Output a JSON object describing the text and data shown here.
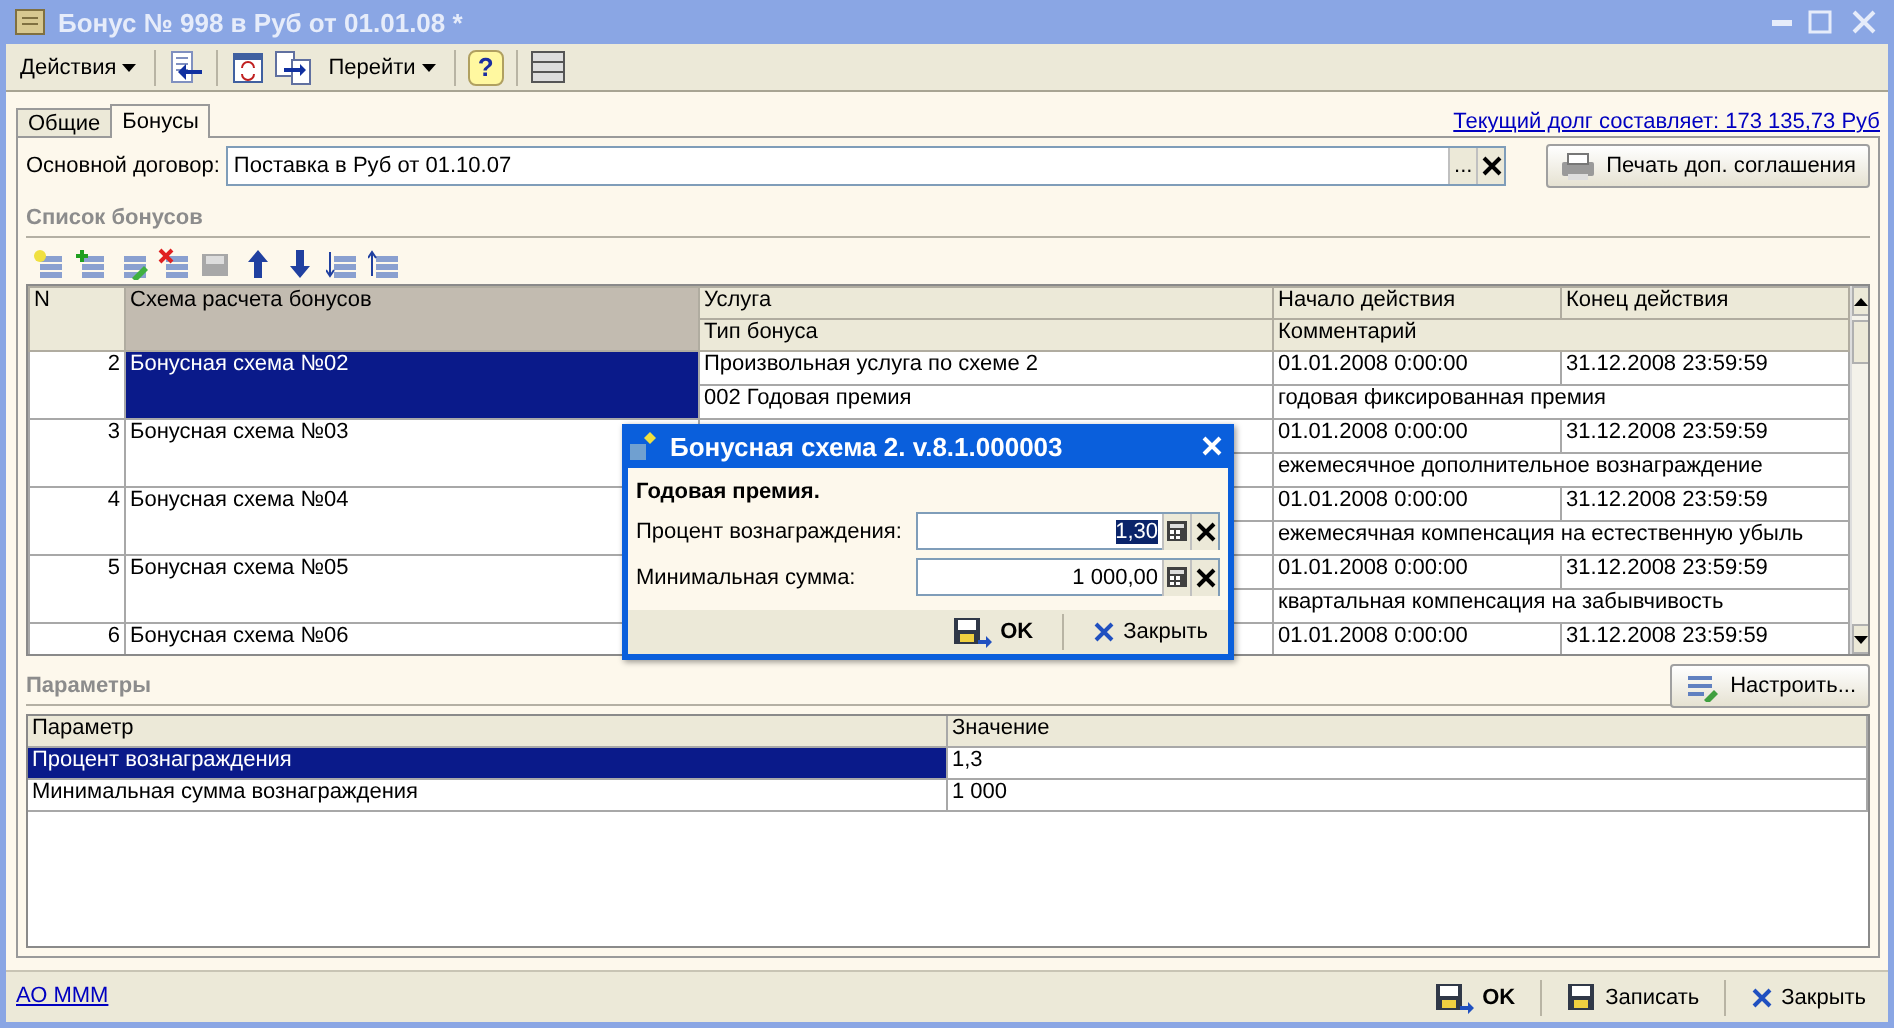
{
  "window": {
    "title": "Бонус № 998 в Руб от 01.01.08 *"
  },
  "toolbar": {
    "menus": [
      "Действия",
      "Перейти"
    ],
    "help": "?"
  },
  "tabs": [
    {
      "label": "Общие",
      "selected": false
    },
    {
      "label": "Бонусы",
      "selected": true
    }
  ],
  "debt_link": "Текущий долг составляет: 173 135,73 Руб",
  "contract": {
    "label": "Основной договор:",
    "value": "Поставка в Руб от 01.10.07",
    "select_button": "..."
  },
  "print_button": "Печать доп. соглашения",
  "bonus_list": {
    "title": "Список бонусов",
    "columns": {
      "n": "N",
      "scheme": "Схема расчета бонусов",
      "service": "Услуга",
      "bonus_type": "Тип бонуса",
      "start": "Начало действия",
      "end": "Конец действия",
      "comment": "Комментарий"
    },
    "rows": [
      {
        "n": "2",
        "scheme": "Бонусная схема №02",
        "service": "Произвольная услуга по схеме 2",
        "bonus_type": "002 Годовая премия",
        "start": "01.01.2008 0:00:00",
        "end": "31.12.2008 23:59:59",
        "comment": "годовая фиксированная премия",
        "selected": true
      },
      {
        "n": "3",
        "scheme": "Бонусная схема №03",
        "start": "01.01.2008 0:00:00",
        "end": "31.12.2008 23:59:59",
        "comment": "ежемесячное дополнительное вознаграждение",
        "selected": false
      },
      {
        "n": "4",
        "scheme": "Бонусная схема №04",
        "start": "01.01.2008 0:00:00",
        "end": "31.12.2008 23:59:59",
        "comment": "ежемесячная компенсация на естественную убыль",
        "selected": false
      },
      {
        "n": "5",
        "scheme": "Бонусная схема №05",
        "start": "01.01.2008 0:00:00",
        "end": "31.12.2008 23:59:59",
        "comment": "квартальная компенсация на забывчивость",
        "selected": false
      },
      {
        "n": "6",
        "scheme": "Бонусная схема №06",
        "start": "01.01.2008 0:00:00",
        "end": "31.12.2008 23:59:59",
        "selected": false
      }
    ]
  },
  "params": {
    "title": "Параметры",
    "configure_button": "Настроить...",
    "columns": [
      "Параметр",
      "Значение"
    ],
    "rows": [
      {
        "name": "Процент вознаграждения",
        "value": "1,3",
        "selected": true
      },
      {
        "name": "Минимальная сумма вознаграждения",
        "value": "1 000",
        "selected": false
      }
    ]
  },
  "dialog": {
    "title": "Бонусная схема 2. v.8.1.000003",
    "heading": "Годовая премия.",
    "fields": [
      {
        "label": "Процент вознаграждения:",
        "value": "1,30",
        "highlighted": true
      },
      {
        "label": "Минимальная сумма:",
        "value": "1 000,00",
        "highlighted": false
      }
    ],
    "ok": "OK",
    "close": "Закрыть"
  },
  "footer": {
    "link": "АО МММ",
    "ok": "OK",
    "save": "Записать",
    "close": "Закрыть"
  }
}
